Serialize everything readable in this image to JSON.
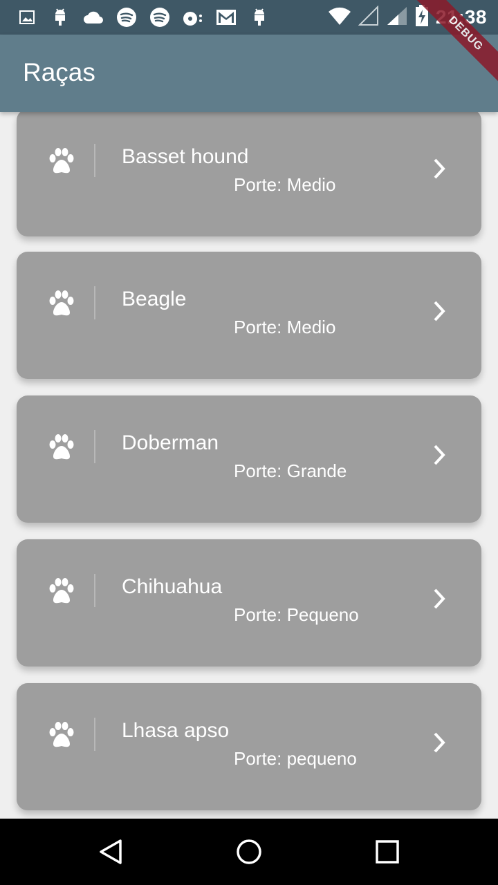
{
  "status_bar": {
    "time": "21:38",
    "left_icons": [
      "image-icon",
      "android-icon",
      "cloud-icon",
      "spotify-icon",
      "spotify-icon",
      "music-icon",
      "gmail-icon",
      "android-icon"
    ],
    "right_icons": [
      "wifi-icon",
      "signal-empty-icon",
      "signal-icon",
      "battery-charging-icon"
    ]
  },
  "debug_label": "DEBUG",
  "app_bar": {
    "title": "Raças"
  },
  "breeds": [
    {
      "name": "Basset hound",
      "size": "Porte: Medio"
    },
    {
      "name": "Beagle",
      "size": "Porte: Medio"
    },
    {
      "name": "Doberman",
      "size": "Porte: Grande"
    },
    {
      "name": "Chihuahua",
      "size": "Porte: Pequeno"
    },
    {
      "name": "Lhasa apso",
      "size": "Porte: pequeno"
    }
  ],
  "nav_bar": {
    "buttons": [
      "back-icon",
      "home-icon",
      "recents-icon"
    ]
  },
  "colors": {
    "status_bar": "#3f5866",
    "app_bar": "#607d8b",
    "card": "#9e9e9e",
    "text": "#ffffff"
  }
}
